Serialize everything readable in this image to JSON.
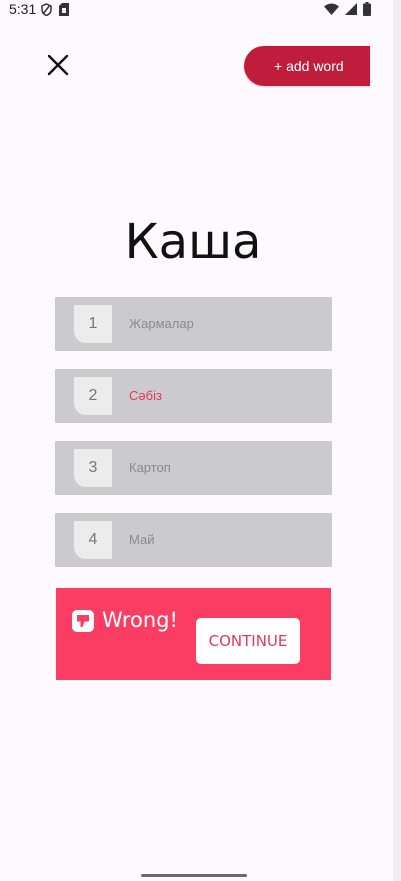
{
  "status_bar": {
    "time": "5:31",
    "icons_left": [
      "shield-icon",
      "sim-card-icon"
    ],
    "icons_right": [
      "wifi-icon",
      "signal-icon",
      "battery-icon"
    ]
  },
  "header": {
    "close_icon": "close-icon",
    "add_word_label": "+ add word"
  },
  "quiz": {
    "word": "Каша",
    "options": [
      {
        "number": "1",
        "label": "Жармалар",
        "state": "default"
      },
      {
        "number": "2",
        "label": "Сәбіз",
        "state": "wrong"
      },
      {
        "number": "3",
        "label": "Картоп",
        "state": "default"
      },
      {
        "number": "4",
        "label": "Май",
        "state": "default"
      }
    ]
  },
  "feedback": {
    "icon": "thumbs-down-icon",
    "text": "Wrong!",
    "continue_label": "CONTINUE"
  },
  "colors": {
    "accent": "#c01c3c",
    "wrong_panel": "#fb3d63",
    "wrong_text": "#e2375a",
    "option_bg": "#cbcbcf"
  }
}
